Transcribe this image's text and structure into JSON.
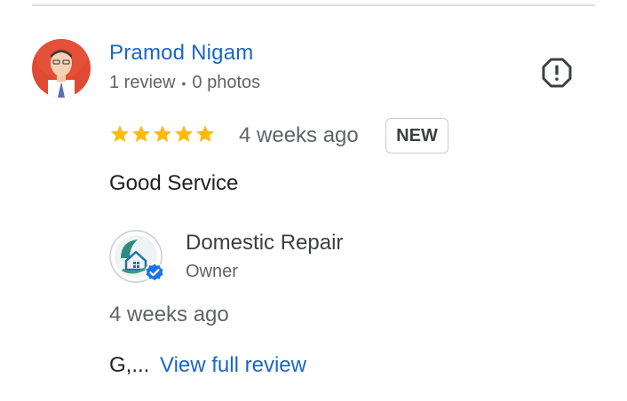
{
  "reviewer": {
    "name": "Pramod Nigam",
    "review_count": "1 review",
    "separator": "•",
    "photo_count": "0 photos"
  },
  "rating": {
    "stars": 5,
    "max_stars": 5,
    "star_color": "#fbbc04",
    "time": "4 weeks ago",
    "badge": "NEW"
  },
  "review_text": "Good Service",
  "owner_reply": {
    "name": "Domestic Repair",
    "role": "Owner",
    "time": "4 weeks ago",
    "snippet": "G,...",
    "link_label": "View full review"
  },
  "colors": {
    "link_blue": "#1a66c8",
    "secondary_text": "#5f6368",
    "verified_blue": "#1a73e8"
  },
  "icons": {
    "report": "report-octagon-icon",
    "star": "star-icon",
    "verified": "verified-badge-icon"
  }
}
